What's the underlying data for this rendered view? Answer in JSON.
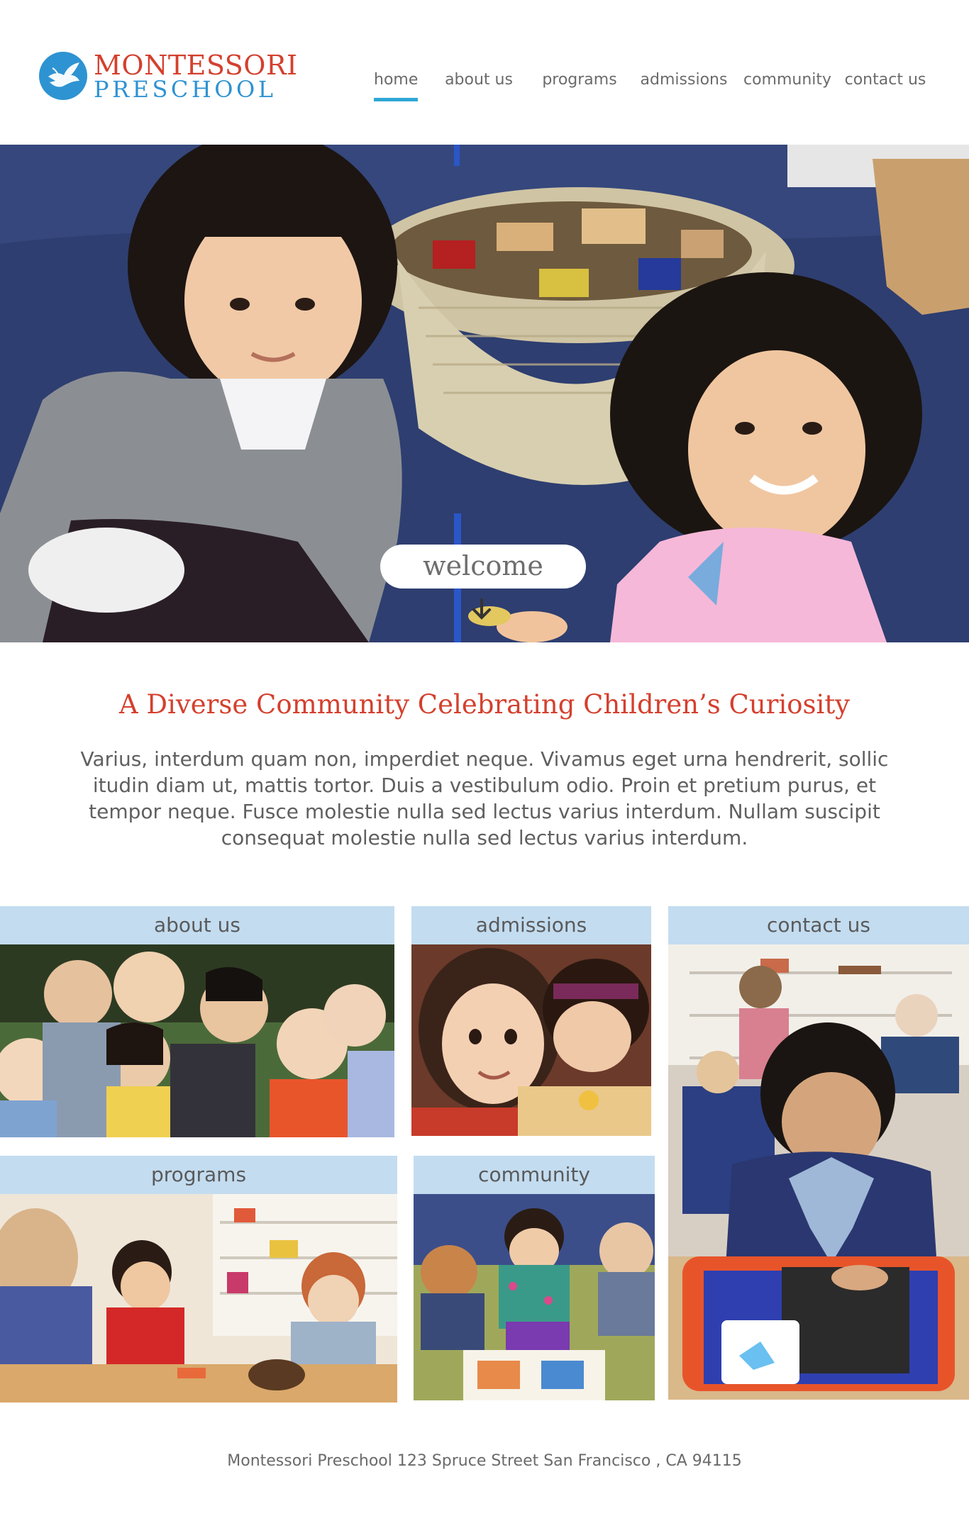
{
  "brand": {
    "line1": "MONTESSORI",
    "line2": "PRESCHOOL",
    "logo_icon": "dove-icon",
    "red": "#d4402e",
    "blue": "#2e93d2"
  },
  "nav": {
    "items": [
      {
        "label": "home",
        "active": true
      },
      {
        "label": "about us"
      },
      {
        "label": "programs"
      },
      {
        "label": "admissions"
      },
      {
        "label": "community"
      },
      {
        "label": "contact us"
      }
    ],
    "accent": "#2ea7d6"
  },
  "hero": {
    "button_label": "welcome",
    "arrow_icon": "arrow-down-icon"
  },
  "intro": {
    "title": "A Diverse Community Celebrating Children’s Curiosity",
    "body": "Varius, interdum quam non, imperdiet neque. Vivamus eget urna hendrerit, sollic itudin diam ut, mattis tortor. Duis a vestibulum odio. Proin et pretium purus, et tempor neque. Fusce molestie nulla sed lectus varius interdum. Nullam suscipit consequat molestie nulla sed lectus varius interdum."
  },
  "tiles": {
    "about": "about us",
    "admissions": "admissions",
    "contact": "contact us",
    "programs": "programs",
    "community": "community",
    "label_bg": "#c3dcf0"
  },
  "footer": {
    "address": "Montessori Preschool 123 Spruce Street San Francisco , CA 94115"
  }
}
